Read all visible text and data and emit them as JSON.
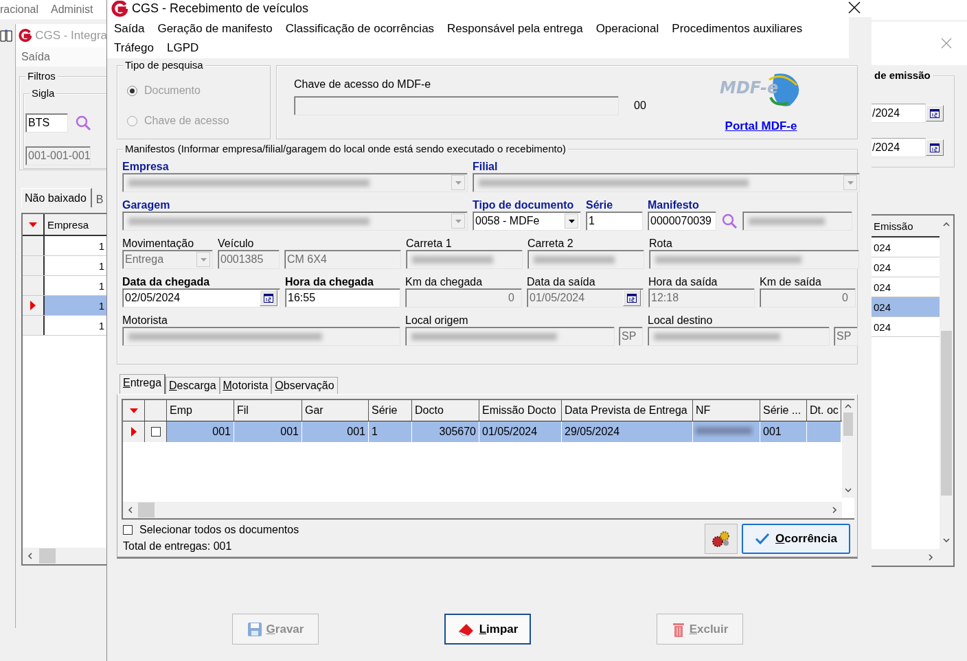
{
  "background_window": {
    "menu": [
      "racional",
      "Administ"
    ],
    "title": "CGS - Integra",
    "menu_items": [
      "Saída"
    ],
    "filters_title": "Filtros",
    "sigla": {
      "title": "Sigla",
      "value": "BTS",
      "code": "001-001-001"
    },
    "tabs": [
      {
        "label": "Não baixado",
        "selected": true
      },
      {
        "label": "B",
        "selected": false
      }
    ],
    "date_group": {
      "title": "de emissão",
      "dates": [
        "/2024",
        "/2024"
      ]
    },
    "grid": {
      "columns": [
        "Empresa",
        "Emissão"
      ],
      "rows": [
        {
          "empresa": "1",
          "emissao": "024",
          "selected": false
        },
        {
          "empresa": "1",
          "emissao": "024",
          "selected": false
        },
        {
          "empresa": "1",
          "emissao": "024",
          "selected": false
        },
        {
          "empresa": "1",
          "emissao": "024",
          "selected": true
        },
        {
          "empresa": "1",
          "emissao": "024",
          "selected": false
        }
      ]
    }
  },
  "dialog": {
    "title": "CGS - Recebimento de veículos",
    "menu": [
      "Saída",
      "Geração de manifesto",
      "Classificação de ocorrências",
      "Responsável pela entrega",
      "Operacional",
      "Procedimentos auxiliares",
      "Tráfego",
      "LGPD"
    ],
    "search_type": {
      "title": "Tipo de pesquisa",
      "disabled": true,
      "options": [
        {
          "label": "Documento",
          "selected": true
        },
        {
          "label": "Chave de acesso",
          "selected": false
        }
      ]
    },
    "access_key": {
      "label": "Chave de acesso do MDF-e",
      "suffix": "00",
      "logo_text": "MDF-e",
      "link": "Portal MDF-e"
    },
    "manifests": {
      "title": "Manifestos (Informar empresa/filial/garagem do local onde está sendo executado o recebimento)",
      "fields": [
        {
          "label": "Empresa",
          "label_bold": true,
          "label_blue": true,
          "kind": "combo",
          "redacted": true,
          "disabled": true
        },
        {
          "label": "Filial",
          "label_bold": true,
          "label_blue": true,
          "kind": "combo",
          "redacted": true,
          "disabled": true
        },
        {
          "label": "Garagem",
          "label_bold": true,
          "label_blue": true,
          "kind": "combo",
          "redacted": true,
          "disabled": true
        },
        {
          "label": "Tipo de documento",
          "label_bold": true,
          "label_blue": true,
          "kind": "combo",
          "value": "0058 - MDFe",
          "disabled": false
        },
        {
          "label": "Série",
          "label_bold": true,
          "label_blue": true,
          "kind": "text",
          "value": "1",
          "disabled": false
        },
        {
          "label": "Manifesto",
          "label_bold": true,
          "label_blue": true,
          "kind": "text",
          "value": "0000070039",
          "disabled": false
        },
        {
          "kind": "search"
        },
        {
          "kind": "text",
          "redacted": true,
          "disabled": true
        },
        {
          "label": "Movimentação",
          "label_bold": false,
          "label_blue": false,
          "kind": "combo",
          "value": "Entrega",
          "disabled": true
        },
        {
          "label": "Veículo",
          "label_bold": false,
          "label_blue": false,
          "kind": "text",
          "value": "0001385",
          "disabled": true
        },
        {
          "kind": "text",
          "value": "CM 6X4",
          "disabled": true
        },
        {
          "label": "Carreta 1",
          "label_bold": false,
          "label_blue": false,
          "kind": "text",
          "redacted": true,
          "disabled": true
        },
        {
          "label": "Carreta 2",
          "label_bold": false,
          "label_blue": false,
          "kind": "text",
          "redacted": true,
          "disabled": true
        },
        {
          "label": "Rota",
          "label_bold": false,
          "label_blue": false,
          "kind": "text",
          "redacted": true,
          "disabled": true
        },
        {
          "label": "Data da chegada",
          "label_bold": true,
          "label_blue": false,
          "kind": "date",
          "value": "02/05/2024",
          "disabled": false
        },
        {
          "label": "Hora da chegada",
          "label_bold": true,
          "label_blue": false,
          "kind": "text",
          "value": "16:55",
          "disabled": false
        },
        {
          "label": "Km da chegada",
          "label_bold": false,
          "label_blue": false,
          "kind": "number",
          "value": "0",
          "disabled": true
        },
        {
          "label": "Data da saída",
          "label_bold": false,
          "label_blue": false,
          "kind": "date",
          "value": "01/05/2024",
          "disabled": true
        },
        {
          "label": "Hora da saída",
          "label_bold": false,
          "label_blue": false,
          "kind": "text",
          "value": "12:18",
          "disabled": true
        },
        {
          "label": "Km de saída",
          "label_bold": false,
          "label_blue": false,
          "kind": "number",
          "value": "0",
          "disabled": true
        },
        {
          "label": "Motorista",
          "label_bold": false,
          "label_blue": false,
          "kind": "text",
          "redacted": true,
          "disabled": true
        },
        {
          "label": "Local origem",
          "label_bold": false,
          "label_blue": false,
          "kind": "text",
          "redacted": true,
          "disabled": true,
          "uf": "SP"
        },
        {
          "label": "Local destino",
          "label_bold": false,
          "label_blue": false,
          "kind": "text",
          "redacted": true,
          "disabled": true,
          "uf": "SP"
        }
      ]
    },
    "tabs": [
      {
        "label": "Entrega",
        "selected": true
      },
      {
        "label": "Descarga",
        "selected": false
      },
      {
        "label": "Motorista",
        "selected": false
      },
      {
        "label": "Observação",
        "selected": false
      }
    ],
    "table": {
      "columns": [
        "Emp",
        "Fil",
        "Gar",
        "Série",
        "Docto",
        "Emissão Docto",
        "Data Prevista de Entrega",
        "NF",
        "Série ...",
        "Dt. oc"
      ],
      "rows": [
        {
          "selected": true,
          "checked": false,
          "cells": [
            {
              "value": "001",
              "right_aligned": true
            },
            {
              "value": "001",
              "right_aligned": true
            },
            {
              "value": "001",
              "right_aligned": true
            },
            {
              "value": "1",
              "right_aligned": false
            },
            {
              "value": "305670",
              "right_aligned": true
            },
            {
              "value": "01/05/2024",
              "right_aligned": false
            },
            {
              "value": "29/05/2024",
              "right_aligned": false
            },
            {
              "redacted": true,
              "right_aligned": false
            },
            {
              "value": "001",
              "right_aligned": false
            },
            {
              "right_aligned": false
            }
          ]
        }
      ]
    },
    "select_all": {
      "label": "Selecionar todos os documentos",
      "checked": false
    },
    "total": "Total de entregas: 001",
    "occurrence_button": "Ocorrência",
    "buttons": [
      {
        "label": "Gravar",
        "kind": "save",
        "disabled": true,
        "focused": false
      },
      {
        "label": "Limpar",
        "kind": "clear",
        "disabled": false,
        "focused": true
      },
      {
        "label": "Excluir",
        "kind": "delete",
        "disabled": true,
        "focused": false
      }
    ]
  }
}
